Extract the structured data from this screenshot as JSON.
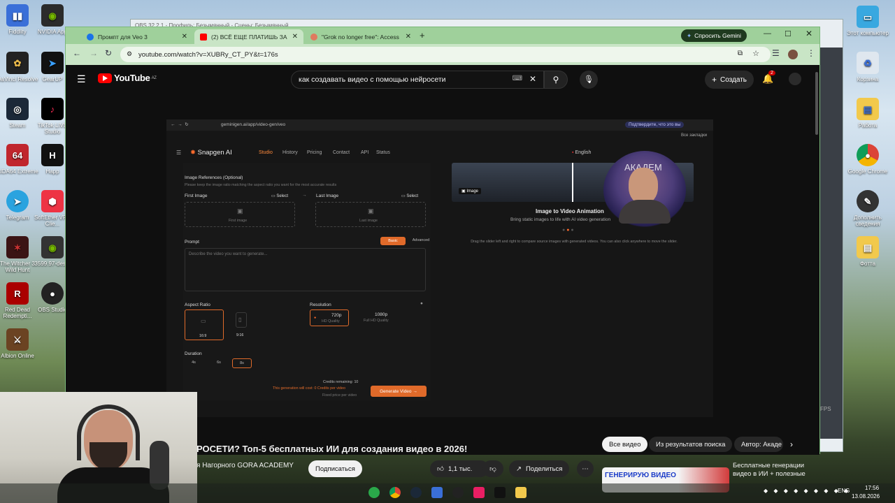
{
  "desktop": {
    "left_icons": [
      "Fiddlity",
      "NVIDIA App",
      "DaVinci Resolve",
      "GearUP",
      "Steam",
      "TikTok LIVE Studio",
      "AIDA64 Extreme",
      "Happ",
      "Telegram",
      "SoftEther VPN Clie...",
      "The Witcher 3 Wild Hunt",
      "3599.97-des...",
      "Red Dead Redempti...",
      "OBS Studio",
      "Albion Online"
    ],
    "right_icons": [
      "Этот компьютер",
      "Корзина",
      "Работа",
      "Google Chrome",
      "Дополнить сведения",
      "Фотта"
    ]
  },
  "obs_back_window": {
    "title": "OBS 32.2.1 - Профиль: Безымянный - Сцены: Безымянный",
    "fps_label": "FPS"
  },
  "chrome": {
    "tabs": [
      {
        "label": "Промпт для Veo 3",
        "color": "#1a73e8"
      },
      {
        "label": "(2) ВСЁ ЕЩЕ ПЛАТИШЬ ЗА",
        "color": "#ff0000"
      },
      {
        "label": "\"Grok no longer free\": Access",
        "color": "#666666"
      }
    ],
    "new_tab": "+",
    "gemini_button": "Спросить Gemini",
    "url": "youtube.com/watch?v=XUBRy_CT_PY&t=176s"
  },
  "youtube": {
    "logo": "YouTube",
    "region": "AZ",
    "search_query": "как создавать видео с помощью нейросети",
    "create_label": "Создать",
    "notifications_count": "2",
    "video_title": "РОСЕТИ? Топ-5 бесплатных ИИ для создания видео в 2026!",
    "channel_name": "я Нагорного GORA ACADEMY",
    "subscribe_label": "Подписаться",
    "likes": "1,1 тыс.",
    "share_label": "Поделиться",
    "filters": [
      "Все видео",
      "Из результатов поиска",
      "Автор: Акаде"
    ],
    "suggest_thumb_text": "ГЕНЕРИРУЮ ВИДЕО",
    "suggest_title": "Бесплатные генерации видео в ИИ + полезные"
  },
  "video_content": {
    "inner_url": "geminigen.ai/app/video-gen/veo",
    "inner_confirm": "Подтвердите, что это вы",
    "inner_bookmarks": "Все закладки",
    "brand": "Snapgen AI",
    "nav": [
      "Studio",
      "History",
      "Pricing",
      "Contact",
      "API",
      "Status"
    ],
    "language": "English",
    "image_refs_title": "Image References (Optional)",
    "image_refs_hint": "Please keep the image ratio matching the aspect ratio you want for the most accurate results",
    "first_image": "First Image",
    "last_image": "Last Image",
    "select": "Select",
    "first_image_placeholder": "First image",
    "last_image_placeholder": "Last image",
    "prompt_label": "Prompt",
    "mode_basic": "Basic",
    "mode_advanced": "Advanced",
    "prompt_placeholder": "Describe the video you want to generate...",
    "aspect_ratio_label": "Aspect Ratio",
    "aspect_options": [
      "16:9",
      "9:16"
    ],
    "resolution_label": "Resolution",
    "res_720": "720p",
    "res_720_sub": "HD Quality",
    "res_1080": "1080p",
    "res_1080_sub": "Full HD Quality",
    "duration_label": "Duration",
    "durations": [
      "4s",
      "6s",
      "8s"
    ],
    "credits_remaining": "Credits remaining: 10",
    "cost_line": "This generation will cost: 0 Credits per video",
    "fixed_price": "Fixed price per video",
    "generate_button": "Generate Video",
    "image_badge": "Image",
    "promo_title": "Image to Video Animation",
    "promo_sub": "Bring static images to life with AI video generation",
    "drag_hint": "Drag the slider left and right to compare source images with generated videos. You can also click anywhere to move the slider.",
    "facecam_text": "АКАДЕМ"
  },
  "taskbar": {
    "lang": "ENG",
    "time": "17:56",
    "date": "13.08.2026"
  }
}
